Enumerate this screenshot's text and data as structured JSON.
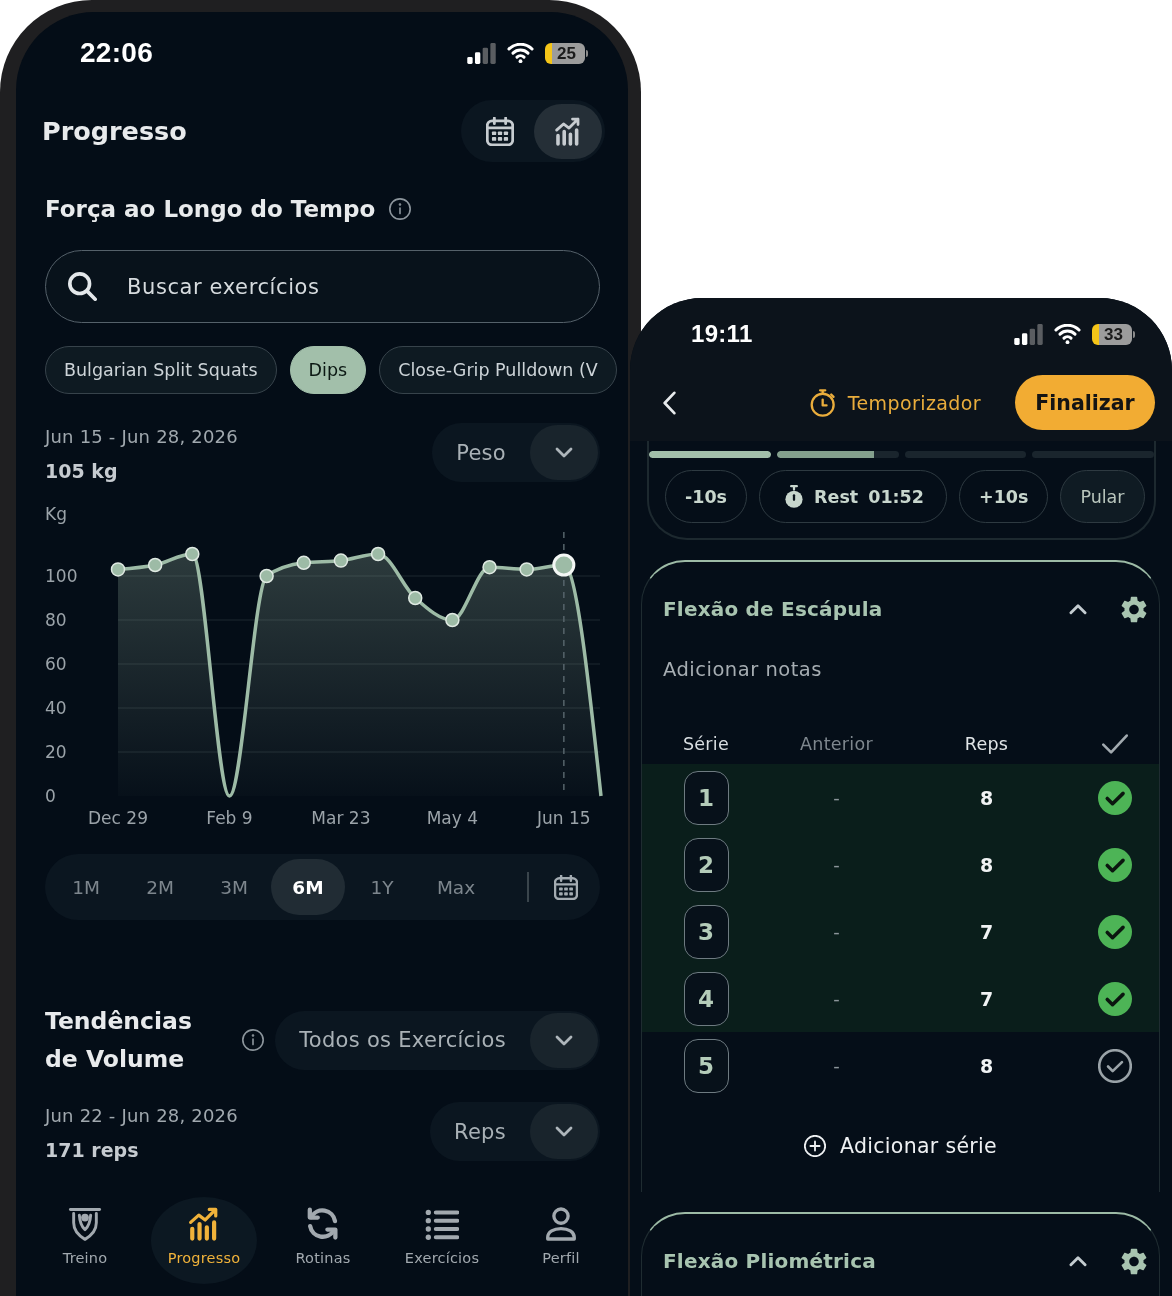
{
  "left_phone": {
    "status_bar": {
      "time": "22:06",
      "battery": "25"
    },
    "header": {
      "title": "Progresso",
      "view_toggle": [
        {
          "kind": "calendar",
          "selected": false
        },
        {
          "kind": "chart",
          "selected": true
        }
      ]
    },
    "strength": {
      "title": "Força ao Longo do Tempo",
      "search": {
        "placeholder": "Buscar exercícios"
      },
      "exercise_chips": [
        {
          "label": "Bulgarian Split Squats",
          "selected": false
        },
        {
          "label": "Dips",
          "selected": true
        },
        {
          "label": "Close-Grip Pulldown (V",
          "selected": false
        }
      ],
      "date_range": "Jun 15 - Jun 28, 2026",
      "total": "105 kg",
      "metric_dropdown": {
        "value": "Peso"
      },
      "chart_data": {
        "type": "area",
        "ylabel": "Kg",
        "categories": [
          "Dec 29",
          null,
          null,
          "Feb 9",
          null,
          null,
          "Mar 23",
          null,
          null,
          "May 4",
          null,
          null,
          "Jun 15",
          null
        ],
        "values": [
          103,
          105,
          110,
          0,
          100,
          106,
          107,
          110,
          90,
          80,
          104,
          103,
          105,
          0
        ],
        "ylim": [
          0,
          120
        ],
        "yticks": [
          0,
          20,
          40,
          60,
          80,
          100
        ],
        "grid": true,
        "annotations": [
          {
            "x": "Jun 15"
          }
        ]
      },
      "ranges": [
        {
          "label": "1M",
          "selected": false
        },
        {
          "label": "2M",
          "selected": false
        },
        {
          "label": "3M",
          "selected": false
        },
        {
          "label": "6M",
          "selected": true
        },
        {
          "label": "1Y",
          "selected": false
        },
        {
          "label": "Max",
          "selected": false
        }
      ]
    },
    "volume": {
      "title": "Tendências de Volume",
      "exercise_dropdown": {
        "value": "Todos os Exercícios"
      },
      "date_range": "Jun 22 - Jun 28, 2026",
      "total": "171 reps",
      "metric_dropdown": {
        "value": "Reps"
      }
    },
    "bottom_nav": [
      {
        "kind": "workout",
        "label": "Treino",
        "selected": false
      },
      {
        "kind": "progress",
        "label": "Progresso",
        "selected": true
      },
      {
        "kind": "routines",
        "label": "Rotinas",
        "selected": false
      },
      {
        "kind": "exercises",
        "label": "Exercícios",
        "selected": false
      },
      {
        "kind": "profile",
        "label": "Perfil",
        "selected": false
      }
    ]
  },
  "right_phone": {
    "status_bar": {
      "time": "19:11",
      "battery": "33"
    },
    "header": {
      "timer_label": "Temporizador",
      "finish_label": "Finalizar"
    },
    "rest": {
      "progress_segments": [
        {
          "level": 1
        },
        {
          "level": 0.8
        },
        {
          "level": 0
        },
        {
          "level": 0
        }
      ],
      "controls": [
        {
          "kind": "adjust",
          "label": "-10s"
        },
        {
          "kind": "timer",
          "label": "Rest 01:52"
        },
        {
          "kind": "adjust",
          "label": "+10s"
        },
        {
          "kind": "skip",
          "label": "Pular"
        }
      ]
    },
    "exercises": [
      {
        "name": "Flexão de Escápula",
        "expanded": true,
        "notes": {
          "placeholder": "Adicionar notas"
        },
        "columns": [
          "Série",
          "Anterior",
          "Reps"
        ],
        "sets": [
          {
            "number": "1",
            "previous": "-",
            "reps": "8",
            "completed": true
          },
          {
            "number": "2",
            "previous": "-",
            "reps": "8",
            "completed": true
          },
          {
            "number": "3",
            "previous": "-",
            "reps": "7",
            "completed": true
          },
          {
            "number": "4",
            "previous": "-",
            "reps": "7",
            "completed": true
          },
          {
            "number": "5",
            "previous": "-",
            "reps": "8",
            "completed": false
          }
        ],
        "add_set_label": "Adicionar série"
      },
      {
        "name": "Flexão Pliométrica",
        "expanded": true
      }
    ]
  }
}
